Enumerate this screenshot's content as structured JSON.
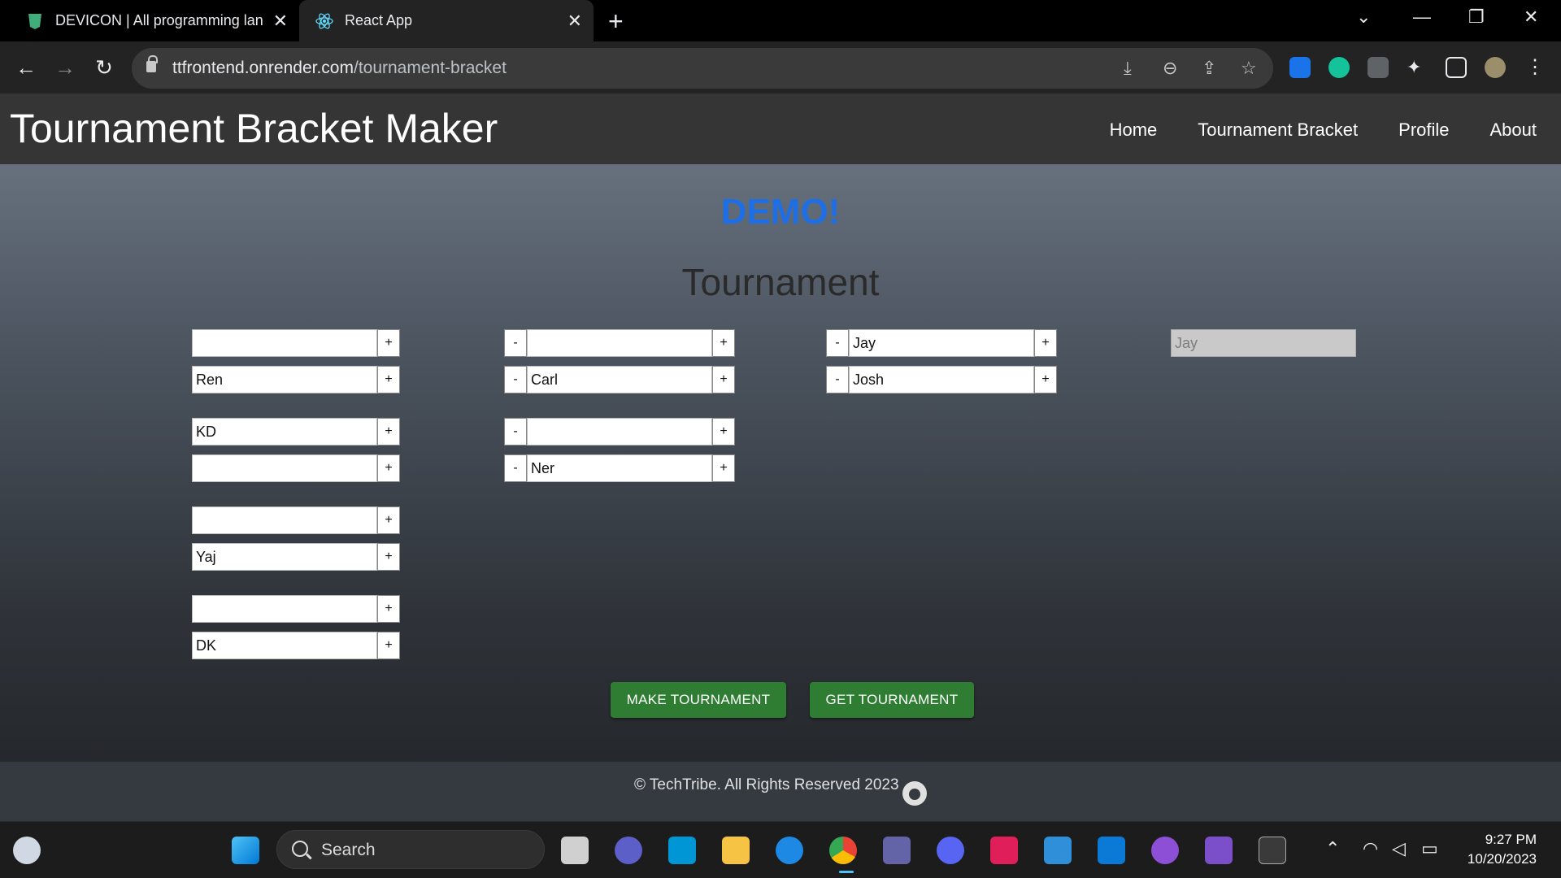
{
  "browser": {
    "tabs": [
      {
        "title": "DEVICON | All programming lan",
        "active": false
      },
      {
        "title": "React App",
        "active": true
      }
    ],
    "url_host": "ttfrontend.onrender.com",
    "url_path": "/tournament-bracket"
  },
  "site": {
    "title": "Tournament Bracket Maker",
    "nav": [
      "Home",
      "Tournament Bracket",
      "Profile",
      "About"
    ]
  },
  "main": {
    "demo_label": "DEMO!",
    "heading": "Tournament",
    "round1": [
      "",
      "Ren",
      "KD",
      "",
      "",
      "Yaj",
      "",
      "DK"
    ],
    "round2": [
      "",
      "Carl",
      "",
      "Ner"
    ],
    "round3": [
      "Jay",
      "Josh"
    ],
    "winner": "Jay",
    "plus_label": "+",
    "minus_label": "-",
    "make_button": "MAKE TOURNAMENT",
    "get_button": "GET TOURNAMENT"
  },
  "footer": {
    "text": "© TechTribe. All Rights Reserved 2023"
  },
  "taskbar": {
    "search_placeholder": "Search",
    "time": "9:27 PM",
    "date": "10/20/2023"
  },
  "colors": {
    "demo": "#1e6fe6",
    "button_green": "#2e7d32",
    "header_bg": "#353535"
  }
}
